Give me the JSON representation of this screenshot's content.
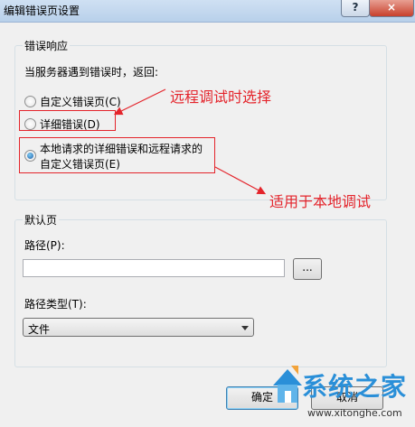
{
  "window": {
    "title": "编辑错误页设置",
    "help_label": "?",
    "close_label": "×"
  },
  "error_response": {
    "legend": "错误响应",
    "prompt": "当服务器遇到错误时，返回:",
    "options": [
      {
        "label": "自定义错误页(C)",
        "selected": false
      },
      {
        "label": "详细错误(D)",
        "selected": false
      },
      {
        "label_line1": "本地请求的详细错误和远程请求的",
        "label_line2": "自定义错误页(E)",
        "selected": true
      }
    ]
  },
  "default_page": {
    "legend": "默认页",
    "path_label": "路径(P):",
    "path_value": "",
    "browse_label": "...",
    "path_type_label": "路径类型(T):",
    "path_type_value": "文件"
  },
  "buttons": {
    "ok_label": "确定",
    "cancel_label": "取消"
  },
  "annotations": {
    "color": "#e4242b",
    "remote_note": "远程调试时选择",
    "local_note": "适用于本地调试"
  },
  "watermark": {
    "name": "系统之家",
    "url": "www.xitonghe.com",
    "color": "#2a8fd8"
  }
}
